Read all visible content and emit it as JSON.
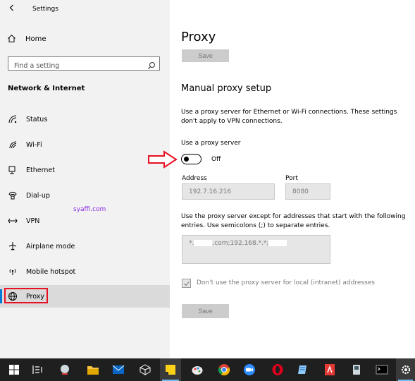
{
  "window": {
    "title": "Settings"
  },
  "sidebar": {
    "home_label": "Home",
    "search_placeholder": "Find a setting",
    "section_heading": "Network & Internet",
    "items": [
      {
        "label": "Status",
        "icon": "status-icon"
      },
      {
        "label": "Wi-Fi",
        "icon": "wifi-icon"
      },
      {
        "label": "Ethernet",
        "icon": "ethernet-icon"
      },
      {
        "label": "Dial-up",
        "icon": "dialup-icon"
      },
      {
        "label": "VPN",
        "icon": "vpn-icon"
      },
      {
        "label": "Airplane mode",
        "icon": "airplane-icon"
      },
      {
        "label": "Mobile hotspot",
        "icon": "hotspot-icon"
      },
      {
        "label": "Proxy",
        "icon": "globe-icon",
        "selected": true
      }
    ],
    "watermark": "syaffi.com"
  },
  "main": {
    "title": "Proxy",
    "top_save_label": "Save",
    "manual_heading": "Manual proxy setup",
    "manual_desc": "Use a proxy server for Ethernet or Wi-Fi connections. These settings don't apply to VPN connections.",
    "toggle_label": "Use a proxy server",
    "toggle_state": "Off",
    "address_label": "Address",
    "address_value": "192.7.16.216",
    "port_label": "Port",
    "port_value": "8080",
    "exceptions_desc": "Use the proxy server except for addresses that start with the following entries. Use semicolons (;) to separate entries.",
    "exceptions_value_part1": "*.",
    "exceptions_value_part2": ".com;192.168.*.*;",
    "checkbox_label": "Don't use the proxy server for local (intranet) addresses",
    "checkbox_checked": true,
    "bottom_save_label": "Save"
  },
  "colors": {
    "accent": "#0078d7",
    "highlight_red": "#e81123",
    "taskbar": "#1f1f1f"
  },
  "taskbar": {
    "icons": [
      "windows-start-icon",
      "task-view-icon",
      "cortana-icon",
      "file-explorer-icon",
      "mail-icon",
      "cube-app-icon",
      "sticky-notes-icon",
      "paint-icon",
      "chrome-icon",
      "zoom-icon",
      "opera-icon",
      "notepad-app-icon",
      "pdf-app-icon",
      "network-app-icon",
      "terminal-icon",
      "settings-gear-icon"
    ]
  }
}
